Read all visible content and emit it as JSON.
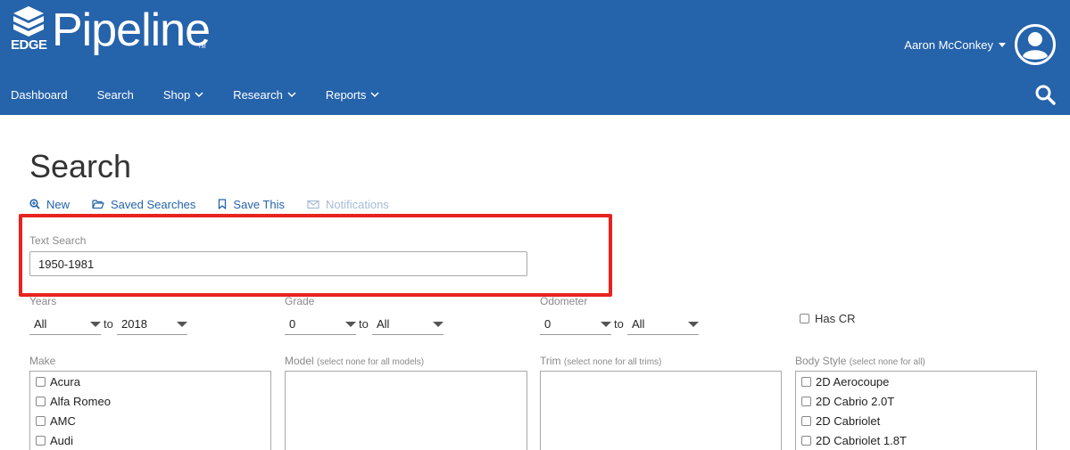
{
  "brand": {
    "edge": "EDGE",
    "name": "Pipeline",
    "tm": "TM"
  },
  "user": {
    "name": "Aaron McConkey"
  },
  "nav": [
    {
      "label": "Dashboard",
      "dropdown": false
    },
    {
      "label": "Search",
      "dropdown": false
    },
    {
      "label": "Shop",
      "dropdown": true
    },
    {
      "label": "Research",
      "dropdown": true
    },
    {
      "label": "Reports",
      "dropdown": true
    }
  ],
  "page": {
    "title": "Search"
  },
  "actions": {
    "new": "New",
    "saved": "Saved Searches",
    "save_this": "Save This",
    "notifications": "Notifications"
  },
  "text_search": {
    "label": "Text Search",
    "value": "1950-1981"
  },
  "years": {
    "label": "Years",
    "from": "All",
    "to_word": "to",
    "to": "2018"
  },
  "grade": {
    "label": "Grade",
    "from": "0",
    "to_word": "to",
    "to": "All"
  },
  "odometer": {
    "label": "Odometer",
    "from": "0",
    "to_word": "to",
    "to": "All"
  },
  "has_cr": {
    "label": "Has CR",
    "checked": false
  },
  "make": {
    "label": "Make",
    "hint": "",
    "items": [
      "Acura",
      "Alfa Romeo",
      "AMC",
      "Audi"
    ]
  },
  "model": {
    "label": "Model",
    "hint": "(select none for all models)",
    "items": []
  },
  "trim": {
    "label": "Trim",
    "hint": "(select none for all trims)",
    "items": []
  },
  "body_style": {
    "label": "Body Style",
    "hint": "(select none for all)",
    "items": [
      "2D Aerocoupe",
      "2D Cabrio 2.0T",
      "2D Cabriolet",
      "2D Cabriolet 1.8T"
    ]
  },
  "colors": {
    "header_bg": "#2563ab",
    "link": "#2563ab",
    "disabled_link": "#a6bbd6",
    "highlight": "#e8231f"
  }
}
